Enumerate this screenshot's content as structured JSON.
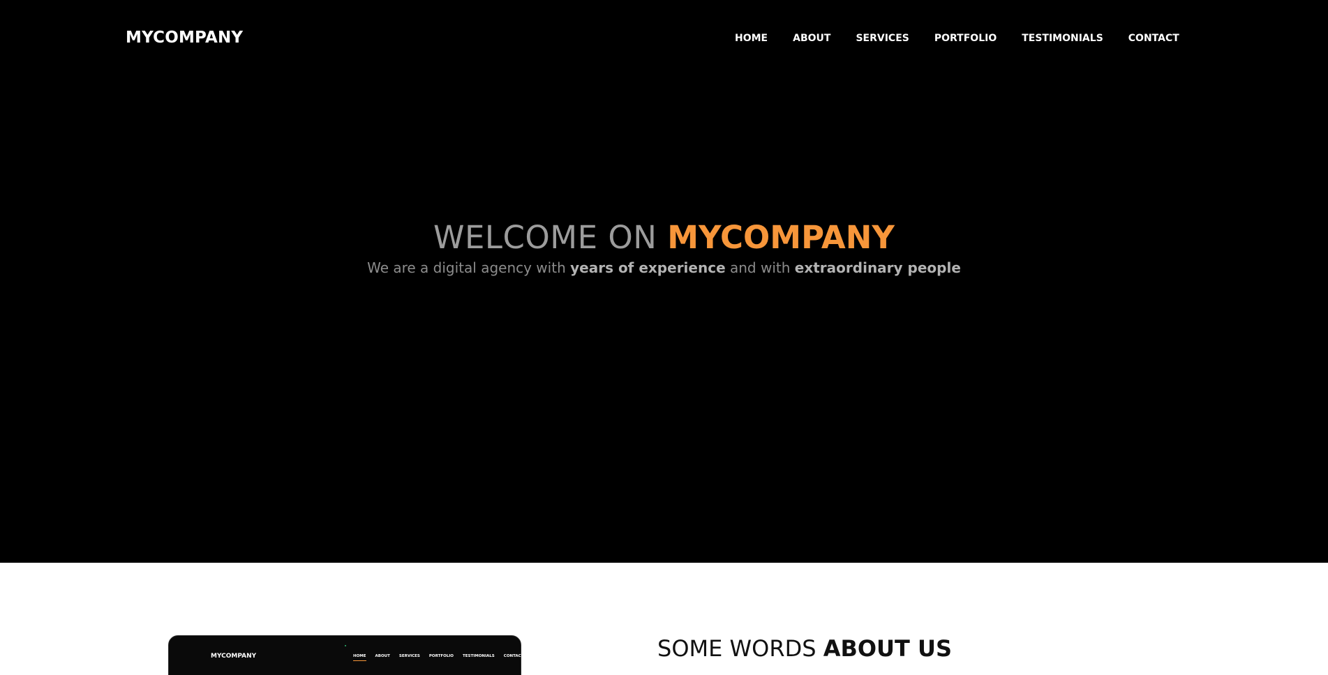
{
  "colors": {
    "hero_background": "#000000",
    "accent": "#f7963a",
    "nav_text": "#ffffff",
    "subtitle_text": "#8c8c8c",
    "about_background": "#ffffff"
  },
  "header": {
    "brand": "MYCOMPANY",
    "nav": [
      {
        "label": "HOME"
      },
      {
        "label": "ABOUT"
      },
      {
        "label": "SERVICES"
      },
      {
        "label": "PORTFOLIO"
      },
      {
        "label": "TESTIMONIALS"
      },
      {
        "label": "CONTACT"
      }
    ]
  },
  "hero": {
    "title_light": "WELCOME ON ",
    "title_accent": "MYCOMPANY",
    "subtitle": {
      "part1": "We are a digital agency with ",
      "bold1": "years of experience",
      "part2": " and with ",
      "bold2": "extraordinary people"
    }
  },
  "about": {
    "title_light": "SOME WORDS ",
    "title_bold": "ABOUT US",
    "preview": {
      "brand": "MYCOMPANY",
      "nav": [
        "HOME",
        "ABOUT",
        "SERVICES",
        "PORTFOLIO",
        "TESTIMONIALS",
        "CONTACT"
      ]
    }
  }
}
